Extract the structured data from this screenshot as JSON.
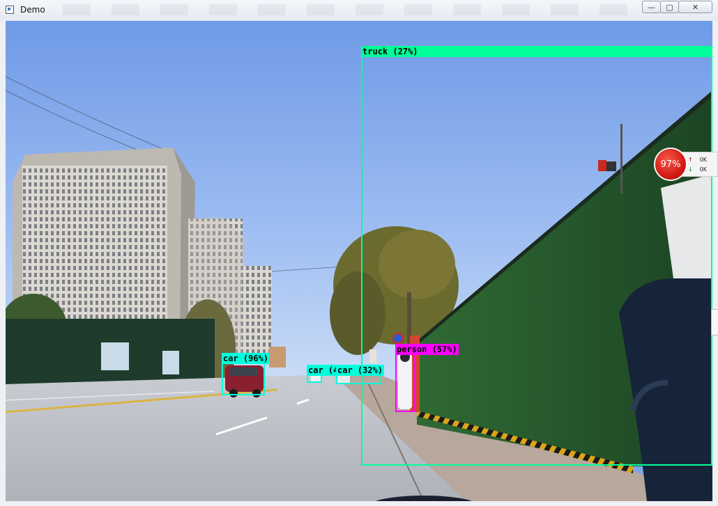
{
  "window": {
    "title": "Demo",
    "min_symbol": "—",
    "max_symbol": "▢",
    "close_symbol": "✕"
  },
  "detections": [
    {
      "class": "truck",
      "label": "truck (27%)",
      "color": "#00ff99"
    },
    {
      "class": "car",
      "label": "car (96%)",
      "color": "#00ffdd"
    },
    {
      "class": "car",
      "label": "car (4",
      "color": "#00ffdd"
    },
    {
      "class": "car",
      "label": "car (32%)",
      "color": "#00ffdd"
    },
    {
      "class": "person",
      "label": "person (57%)",
      "color": "#ff00ff"
    }
  ],
  "net_widget": {
    "percent": "97%",
    "upload": "0K",
    "download": "0K"
  }
}
